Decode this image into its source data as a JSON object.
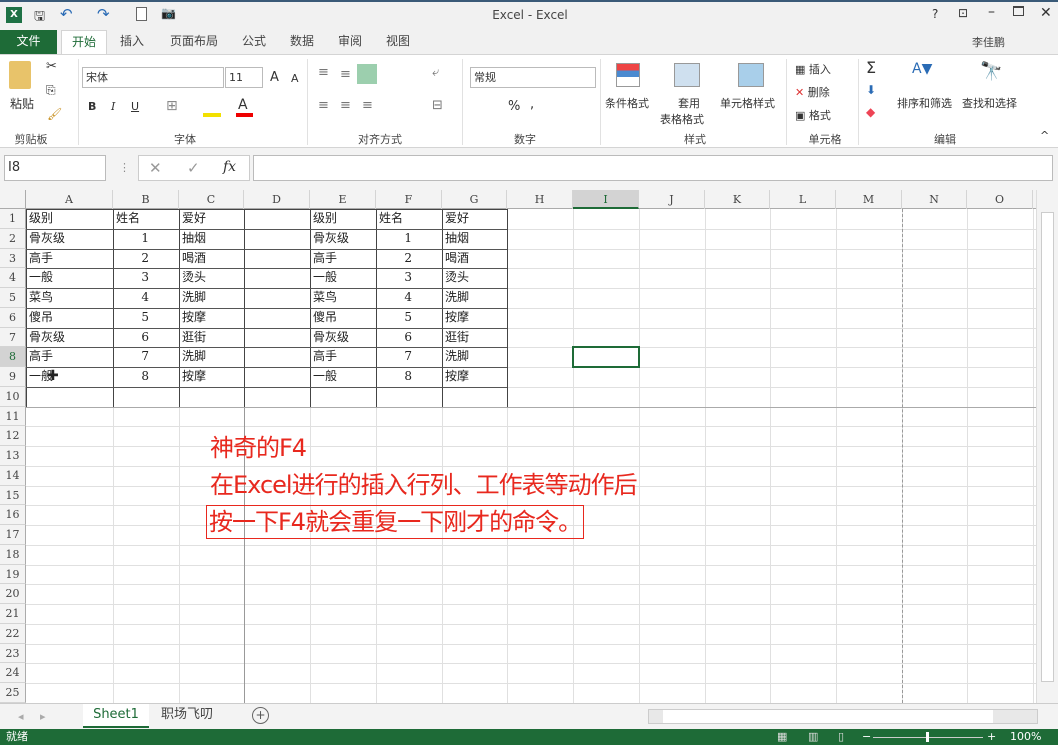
{
  "title": "Excel - Excel",
  "user": "李佳鹏",
  "tabs": [
    "文件",
    "开始",
    "插入",
    "页面布局",
    "公式",
    "数据",
    "审阅",
    "视图"
  ],
  "ribbon": {
    "paste": "粘贴",
    "clipboard": "剪贴板",
    "font_name": "宋体",
    "font_size": "11",
    "font": "字体",
    "alignment": "对齐方式",
    "number_format": "常规",
    "number": "数字",
    "cond_format": "条件格式",
    "table_format_1": "套用",
    "table_format_2": "表格格式",
    "cell_styles": "单元格样式",
    "styles": "样式",
    "insert": "插入",
    "delete": "删除",
    "format": "格式",
    "cells": "单元格",
    "sort_filter": "排序和筛选",
    "find_select": "查找和选择",
    "editing": "编辑"
  },
  "formula_bar": {
    "name_box": "I8",
    "fx": "fx",
    "value": ""
  },
  "columns": [
    "A",
    "B",
    "C",
    "D",
    "E",
    "F",
    "G",
    "H",
    "I",
    "J",
    "K",
    "L",
    "M",
    "N",
    "O"
  ],
  "rows": [
    "1",
    "2",
    "3",
    "4",
    "5",
    "6",
    "7",
    "8",
    "9",
    "10",
    "11",
    "12",
    "13",
    "14",
    "15",
    "16",
    "17",
    "18",
    "19",
    "20",
    "21",
    "22",
    "23",
    "24",
    "25"
  ],
  "table_left": [
    [
      "级别",
      "姓名",
      "爱好"
    ],
    [
      "骨灰级",
      "1",
      "抽烟"
    ],
    [
      "高手",
      "2",
      "喝酒"
    ],
    [
      "一般",
      "3",
      "烫头"
    ],
    [
      "菜鸟",
      "4",
      "洗脚"
    ],
    [
      "傻吊",
      "5",
      "按摩"
    ],
    [
      "骨灰级",
      "6",
      "逛街"
    ],
    [
      "高手",
      "7",
      "洗脚"
    ],
    [
      "一般",
      "8",
      "按摩"
    ]
  ],
  "table_right": [
    [
      "级别",
      "姓名",
      "爱好"
    ],
    [
      "骨灰级",
      "1",
      "抽烟"
    ],
    [
      "高手",
      "2",
      "喝酒"
    ],
    [
      "一般",
      "3",
      "烫头"
    ],
    [
      "菜鸟",
      "4",
      "洗脚"
    ],
    [
      "傻吊",
      "5",
      "按摩"
    ],
    [
      "骨灰级",
      "6",
      "逛街"
    ],
    [
      "高手",
      "7",
      "洗脚"
    ],
    [
      "一般",
      "8",
      "按摩"
    ]
  ],
  "note": {
    "line1": "神奇的F4",
    "line2": "在Excel进行的插入行列、工作表等动作后",
    "line3": "按一下F4就会重复一下刚才的命令。"
  },
  "sheets": [
    "Sheet1",
    "职场飞叨"
  ],
  "status": {
    "ready": "就绪",
    "zoom": "100%"
  },
  "colors": {
    "accent": "#1e6b37",
    "note": "#e8281e"
  }
}
